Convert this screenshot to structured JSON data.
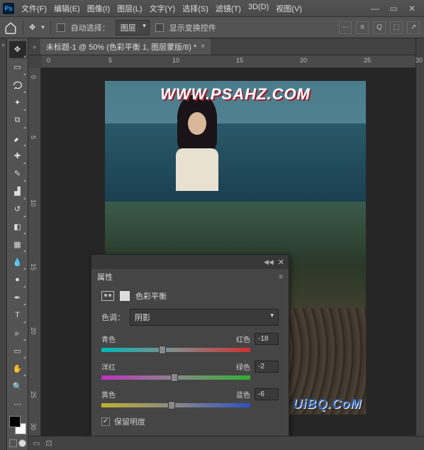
{
  "menu": {
    "file": "文件(F)",
    "edit": "编辑(E)",
    "image": "图像(I)",
    "layer": "图层(L)",
    "type": "文字(Y)",
    "select": "选择(S)",
    "filter": "滤镜(T)",
    "threeD": "3D(D)",
    "view": "视图(V)"
  },
  "options": {
    "auto_select": "自动选择：",
    "target": "图层",
    "show_transform": "显示变换控件"
  },
  "document": {
    "tab_title": "未标题-1 @ 50% (色彩平衡 1, 图层蒙版/8) *"
  },
  "ruler_h": [
    "0",
    "5",
    "10",
    "15",
    "20",
    "25",
    "30"
  ],
  "ruler_v": [
    "0",
    "5",
    "10",
    "15",
    "20",
    "25",
    "30"
  ],
  "canvas": {
    "watermark": "WWW.PSAHZ.COM",
    "watermark2": "UiBQ.CoM"
  },
  "panel": {
    "tab": "属性",
    "adjustment": "色彩平衡",
    "tone_label": "色调：",
    "tone_value": "阴影",
    "preserve": "保留明度",
    "sliders": [
      {
        "left": "青色",
        "right": "红色",
        "value": "-18",
        "pos": 41
      },
      {
        "left": "洋红",
        "right": "绿色",
        "value": "-2",
        "pos": 49
      },
      {
        "left": "黄色",
        "right": "蓝色",
        "value": "-6",
        "pos": 47
      }
    ]
  }
}
